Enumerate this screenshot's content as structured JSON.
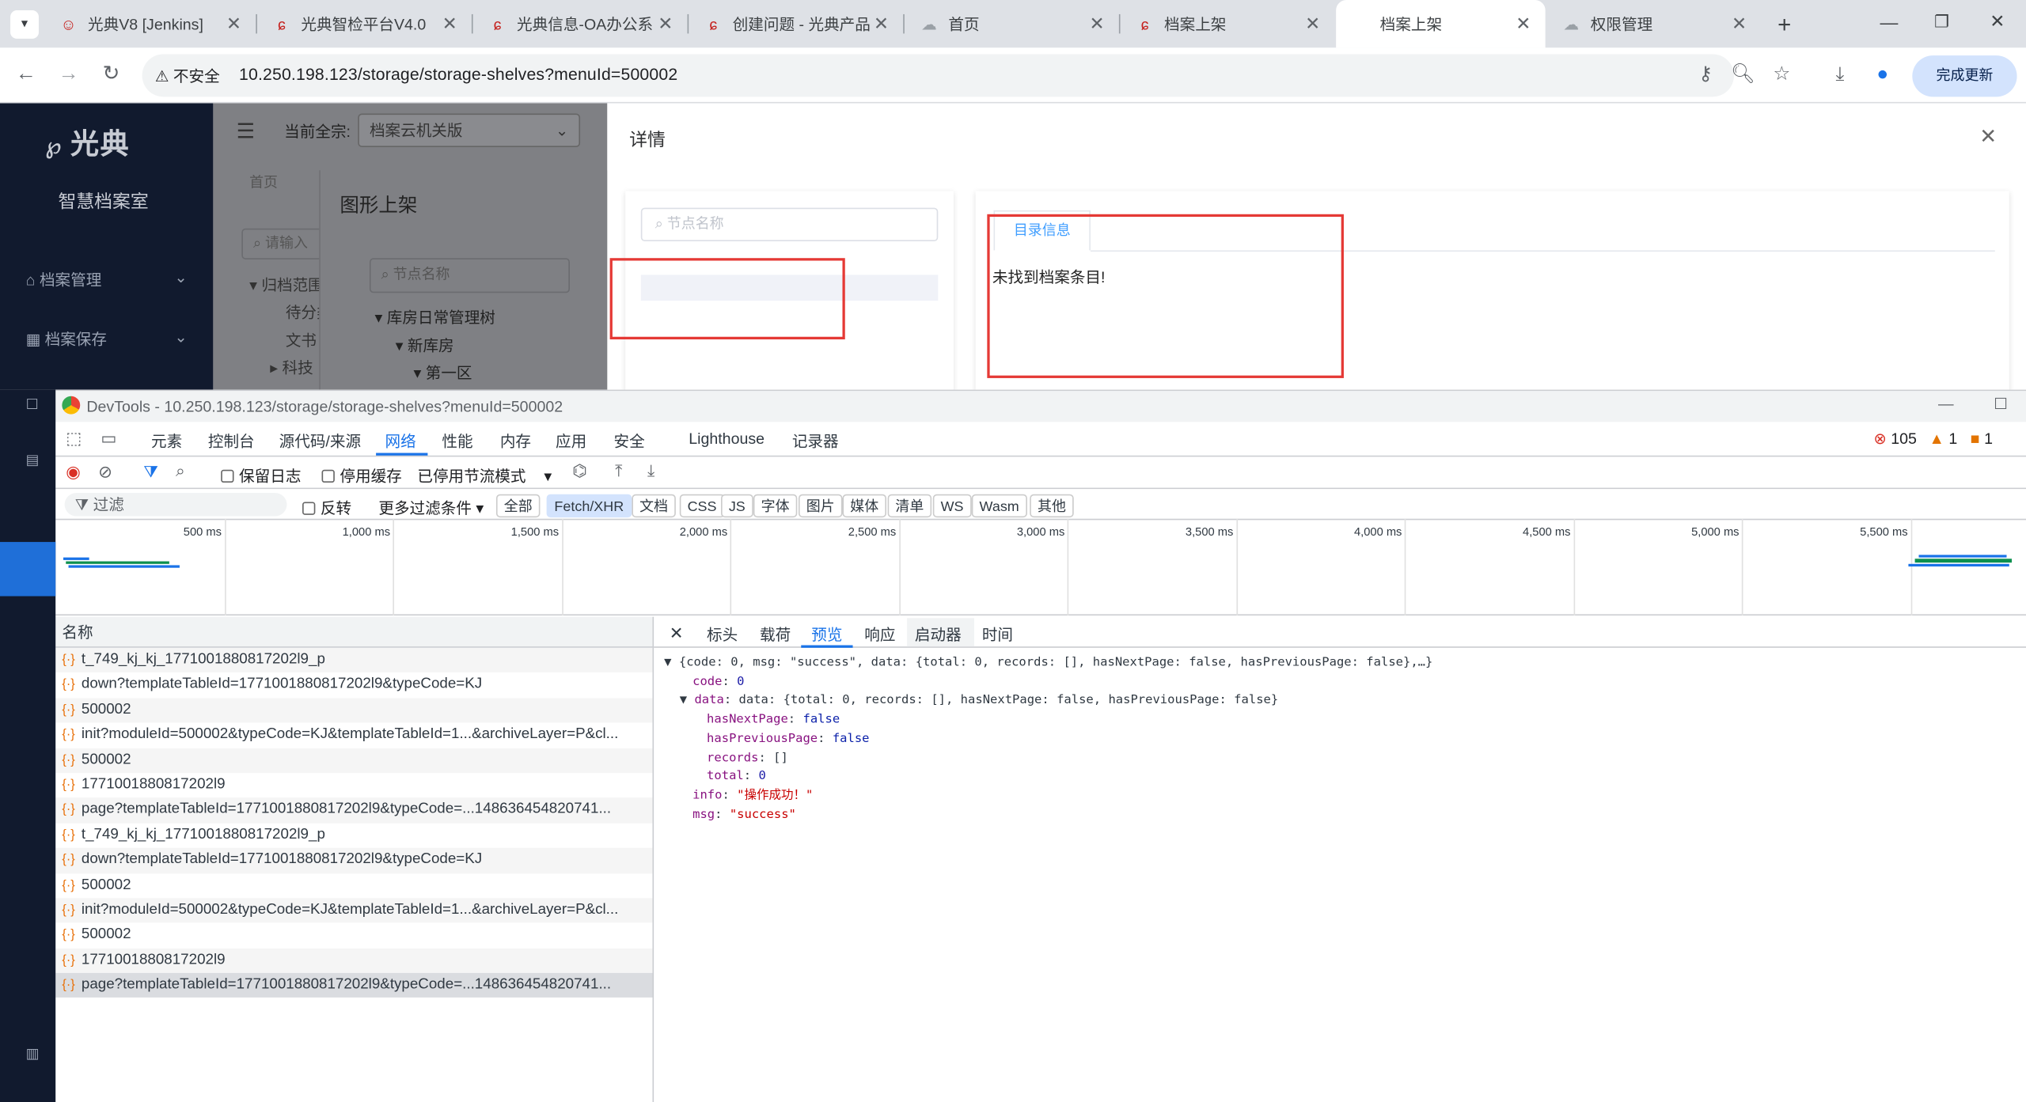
{
  "browser": {
    "tabs": [
      {
        "label": "光典V8 [Jenkins]"
      },
      {
        "label": "光典智检平台V4.0"
      },
      {
        "label": "光典信息-OA办公系"
      },
      {
        "label": "创建问题 - 光典产品"
      },
      {
        "label": "首页"
      },
      {
        "label": "档案上架"
      },
      {
        "label": "档案上架"
      },
      {
        "label": "权限管理"
      }
    ],
    "security_label": "不安全",
    "url": "10.250.198.123/storage/storage-shelves?menuId=500002",
    "update_button": "完成更新"
  },
  "app": {
    "logo": "光典",
    "logo_subtitle": "智慧档案室",
    "menu": [
      "档案管理",
      "档案保存"
    ],
    "current_fonds_label": "当前全宗:",
    "current_fonds_value": "档案云机关版",
    "home_tab": "首页",
    "search_placeholder_left": "请输入",
    "tree_left": [
      "归档范围",
      "待分类",
      "文书",
      "科技"
    ],
    "dialog_title": "图形上架",
    "dialog_search_placeholder": "节点名称",
    "dialog_tree": [
      "库房日常管理树",
      "新库房",
      "第一区"
    ]
  },
  "drawer": {
    "title": "详情",
    "node_search_placeholder": "节点名称",
    "tab_catalog": "目录信息",
    "not_found": "未找到档案条目!"
  },
  "devtools": {
    "title": "DevTools - 10.250.198.123/storage/storage-shelves?menuId=500002",
    "tabs": [
      "元素",
      "控制台",
      "源代码/来源",
      "网络",
      "性能",
      "内存",
      "应用",
      "安全",
      "Lighthouse",
      "记录器"
    ],
    "selected_tab": "网络",
    "errors": "105",
    "warnings": "1",
    "issues": "1",
    "preserve_log": "保留日志",
    "disable_cache": "停用缓存",
    "throttle": "已停用节流模式",
    "filter_placeholder": "过滤",
    "invert": "反转",
    "more_filters": "更多过滤条件",
    "type_filters": [
      "全部",
      "Fetch/XHR",
      "文档",
      "CSS",
      "JS",
      "字体",
      "图片",
      "媒体",
      "清单",
      "WS",
      "Wasm",
      "其他"
    ],
    "selected_filter": "Fetch/XHR",
    "timeline_ticks": [
      "500 ms",
      "1,000 ms",
      "1,500 ms",
      "2,000 ms",
      "2,500 ms",
      "3,000 ms",
      "3,500 ms",
      "4,000 ms",
      "4,500 ms",
      "5,000 ms",
      "5,500 ms"
    ],
    "name_header": "名称",
    "requests": [
      "t_749_kj_kj_1771001880817202l9_p",
      "down?templateTableId=1771001880817202l9&typeCode=KJ",
      "500002",
      "init?moduleId=500002&typeCode=KJ&templateTableId=1...&archiveLayer=P&cl...",
      "500002",
      "1771001880817202l9",
      "page?templateTableId=1771001880817202l9&typeCode=...148636454820741...",
      "t_749_kj_kj_1771001880817202l9_p",
      "down?templateTableId=1771001880817202l9&typeCode=KJ",
      "500002",
      "init?moduleId=500002&typeCode=KJ&templateTableId=1...&archiveLayer=P&cl...",
      "500002",
      "1771001880817202l9",
      "page?templateTableId=1771001880817202l9&typeCode=...148636454820741..."
    ],
    "detail_tabs": [
      "标头",
      "载荷",
      "预览",
      "响应",
      "启动器",
      "时间"
    ],
    "selected_detail_tab": "预览",
    "preview": {
      "summary": "{code: 0, msg: \"success\", data: {total: 0, records: [], hasNextPage: false, hasPreviousPage: false},…}",
      "code_line": "code: 0",
      "data_summary": "data: {total: 0, records: [], hasNextPage: false, hasPreviousPage: false}",
      "hasNextPage": "false",
      "hasPreviousPage": "false",
      "records": "[]",
      "total": "0",
      "info": "\"操作成功！\"",
      "msg": "\"success\""
    }
  },
  "colors": {
    "accent": "#1a73e8",
    "sidebar": "#111a2e",
    "highlight_box": "#e53935"
  }
}
